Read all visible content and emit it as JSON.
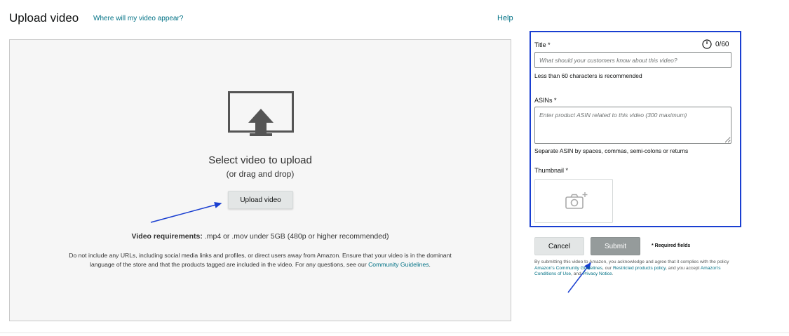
{
  "header": {
    "title": "Upload video",
    "where_link": "Where will my video appear?",
    "help_link": "Help"
  },
  "dropzone": {
    "icon": "upload-monitor-icon",
    "title": "Select video to upload",
    "subtitle": "(or drag and drop)",
    "button_label": "Upload video",
    "requirements_label": "Video requirements:",
    "requirements_text": ".mp4 or .mov under 5GB (480p or higher recommended)",
    "policy_text": "Do not include any URLs, including social media links and profiles, or direct users away from Amazon. Ensure that your video is in the dominant language of the store and that the products tagged are included in the video. For any questions, see our",
    "policy_link": "Community Guidelines",
    "policy_end": "."
  },
  "form": {
    "title_label": "Title *",
    "title_count": "0/60",
    "title_placeholder": "What should your customers know about this video?",
    "title_value": "",
    "title_hint": "Less than 60 characters is recommended",
    "asin_label": "ASINs *",
    "asin_placeholder": "Enter product ASIN related to this video (300 maximum)",
    "asin_value": "",
    "asin_hint": "Separate ASIN by spaces, commas, semi-colons or returns",
    "thumbnail_label": "Thumbnail *",
    "thumbnail_icon": "add-photo-camera-icon"
  },
  "actions": {
    "cancel_label": "Cancel",
    "submit_label": "Submit",
    "required_note": "* Required fields"
  },
  "consent": {
    "text1": "By submitting this video to Amazon, you acknowledge and agree that it complies with the policy",
    "link1": "Amazon's Community Guidelines",
    "text2": ", our",
    "link2": "Restricted products policy",
    "text3": ", and you accept",
    "link3": "Amazon's Conditions of Use",
    "text4": ", and",
    "link4": "Privacy Notice",
    "text5": "."
  },
  "colors": {
    "link": "#007185",
    "highlight_border": "#1a3fd1",
    "annotation_arrow": "#1a3fd1",
    "submit_disabled": "#959b9b",
    "dropzone_bg": "#f6f6f6"
  }
}
